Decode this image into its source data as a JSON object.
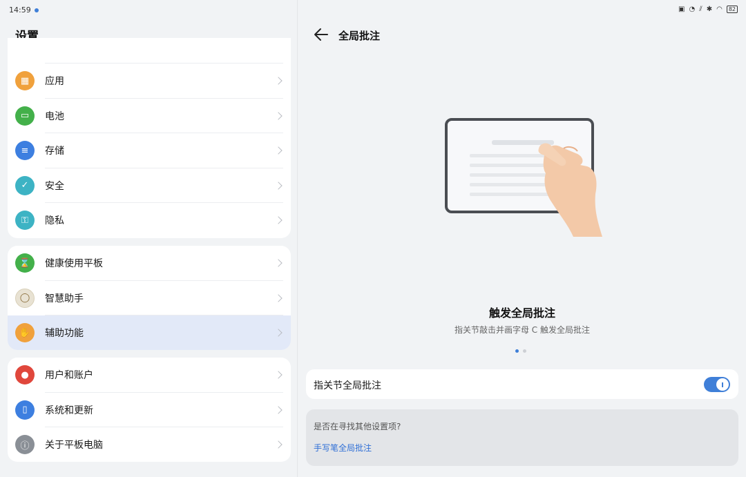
{
  "status": {
    "time": "14:59",
    "battery": "82"
  },
  "left": {
    "title": "设置",
    "group1": [
      {
        "label": "应用",
        "icon": "apps-icon",
        "color": "#f0a13c"
      },
      {
        "label": "电池",
        "icon": "battery-icon",
        "color": "#43b04a"
      },
      {
        "label": "存储",
        "icon": "storage-icon",
        "color": "#3d7fe0"
      },
      {
        "label": "安全",
        "icon": "shield-icon",
        "color": "#3db3c4"
      },
      {
        "label": "隐私",
        "icon": "privacy-icon",
        "color": "#3db3c4"
      }
    ],
    "group2": [
      {
        "label": "健康使用平板",
        "icon": "hourglass-icon",
        "color": "#43b04a"
      },
      {
        "label": "智慧助手",
        "icon": "yoyo-icon",
        "color": "#e8e2d3"
      },
      {
        "label": "辅助功能",
        "icon": "hand-icon",
        "color": "#f0a13c"
      }
    ],
    "group3": [
      {
        "label": "用户和账户",
        "icon": "user-icon",
        "color": "#e0473c"
      },
      {
        "label": "系统和更新",
        "icon": "system-update-icon",
        "color": "#3d7fe0"
      },
      {
        "label": "关于平板电脑",
        "icon": "tablet-info-icon",
        "color": "#8a8f96"
      }
    ]
  },
  "right": {
    "title": "全局批注",
    "illustration_title": "触发全局批注",
    "illustration_subtitle": "指关节敲击并画字母 C 触发全局批注",
    "toggle_label": "指关节全局批注",
    "suggest_question": "是否在寻找其他设置项?",
    "suggest_link": "手写笔全局批注"
  },
  "colors": {
    "accent": "#3f7fd8",
    "link": "#2f6fd6",
    "active_row": "#e2e9f8"
  }
}
